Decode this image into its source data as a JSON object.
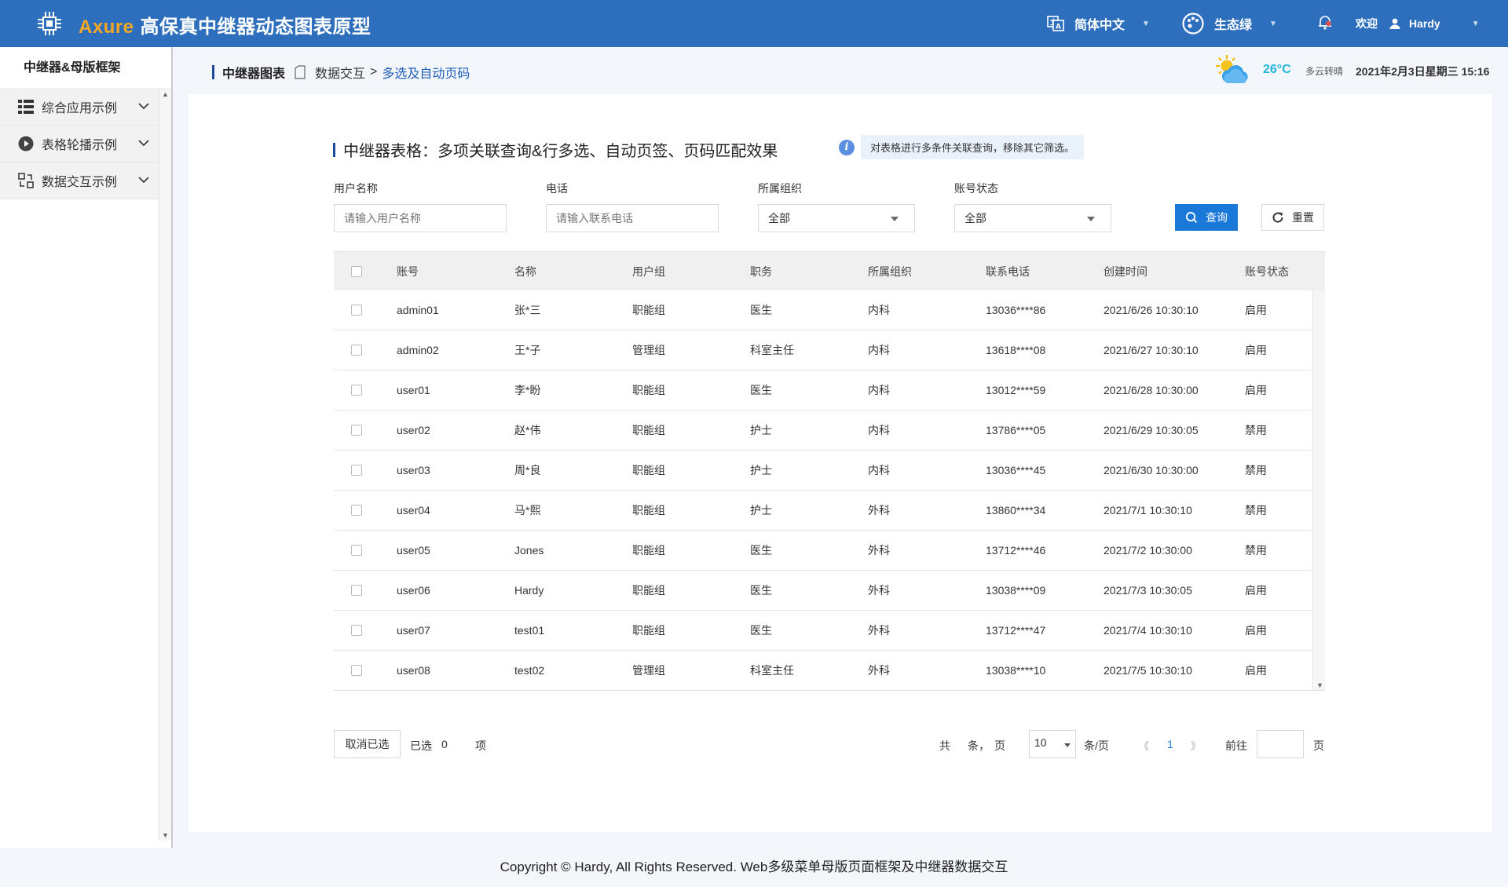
{
  "header": {
    "brand": "Axure",
    "title": "高保真中继器动态图表原型",
    "language": "简体中文",
    "theme": "生态绿",
    "welcome": "欢迎",
    "user": "Hardy"
  },
  "sidebar": {
    "title": "中继器&母版框架",
    "items": [
      {
        "label": "综合应用示例",
        "icon": "grid-list-icon"
      },
      {
        "label": "表格轮播示例",
        "icon": "play-circle-icon"
      },
      {
        "label": "数据交互示例",
        "icon": "data-exchange-icon"
      }
    ]
  },
  "breadcrumb": {
    "root": "中继器图表",
    "parent": "数据交互",
    "separator": ">",
    "current": "多选及自动页码"
  },
  "weather": {
    "temp": "26°C",
    "condition": "多云转晴",
    "datetime": "2021年2月3日星期三 15:16"
  },
  "panel": {
    "title": "中继器表格：多项关联查询&行多选、自动页签、页码匹配效果",
    "tip": "对表格进行多条件关联查询，移除其它筛选。"
  },
  "filters": {
    "username": {
      "label": "用户名称",
      "placeholder": "请输入用户名称"
    },
    "phone": {
      "label": "电话",
      "placeholder": "请输入联系电话"
    },
    "org": {
      "label": "所属组织",
      "value": "全部"
    },
    "status": {
      "label": "账号状态",
      "value": "全部"
    },
    "query_label": "查询",
    "reset_label": "重置"
  },
  "table": {
    "columns": [
      "账号",
      "名称",
      "用户组",
      "职务",
      "所属组织",
      "联系电话",
      "创建时间",
      "账号状态"
    ],
    "rows": [
      [
        "admin01",
        "张*三",
        "职能组",
        "医生",
        "内科",
        "13036****86",
        "2021/6/26 10:30:10",
        "启用"
      ],
      [
        "admin02",
        "王*子",
        "管理组",
        "科室主任",
        "内科",
        "13618****08",
        "2021/6/27 10:30:10",
        "启用"
      ],
      [
        "user01",
        "李*盼",
        "职能组",
        "医生",
        "内科",
        "13012****59",
        "2021/6/28 10:30:00",
        "启用"
      ],
      [
        "user02",
        "赵*伟",
        "职能组",
        "护士",
        "内科",
        "13786****05",
        "2021/6/29 10:30:05",
        "禁用"
      ],
      [
        "user03",
        "周*良",
        "职能组",
        "护士",
        "内科",
        "13036****45",
        "2021/6/30 10:30:00",
        "禁用"
      ],
      [
        "user04",
        "马*熙",
        "职能组",
        "护士",
        "外科",
        "13860****34",
        "2021/7/1 10:30:10",
        "禁用"
      ],
      [
        "user05",
        "Jones",
        "职能组",
        "医生",
        "外科",
        "13712****46",
        "2021/7/2 10:30:00",
        "禁用"
      ],
      [
        "user06",
        "Hardy",
        "职能组",
        "医生",
        "外科",
        "13038****09",
        "2021/7/3 10:30:05",
        "启用"
      ],
      [
        "user07",
        "test01",
        "职能组",
        "医生",
        "外科",
        "13712****47",
        "2021/7/4 10:30:10",
        "启用"
      ],
      [
        "user08",
        "test02",
        "管理组",
        "科室主任",
        "外科",
        "13038****10",
        "2021/7/5 10:30:10",
        "启用"
      ]
    ]
  },
  "bottom": {
    "cancel_label": "取消已选",
    "selected_prefix": "已选",
    "selected_count": "0",
    "selected_suffix": "项",
    "total_prefix": "共",
    "total_mid": "条，",
    "total_suffix": "页",
    "page_size": "10",
    "page_size_unit": "条/页",
    "prev": "《",
    "current_page": "1",
    "next": "》",
    "goto_prefix": "前往",
    "goto_suffix": "页"
  },
  "footer": "Copyright © Hardy, All Rights Reserved.  Web多级菜单母版页面框架及中继器数据交互",
  "colors": {
    "header_bg": "#2e6fbd",
    "brand": "#f5a623",
    "primary_button": "#1a78d8",
    "link": "#1e5eb8",
    "temperature": "#1fb5d8"
  }
}
